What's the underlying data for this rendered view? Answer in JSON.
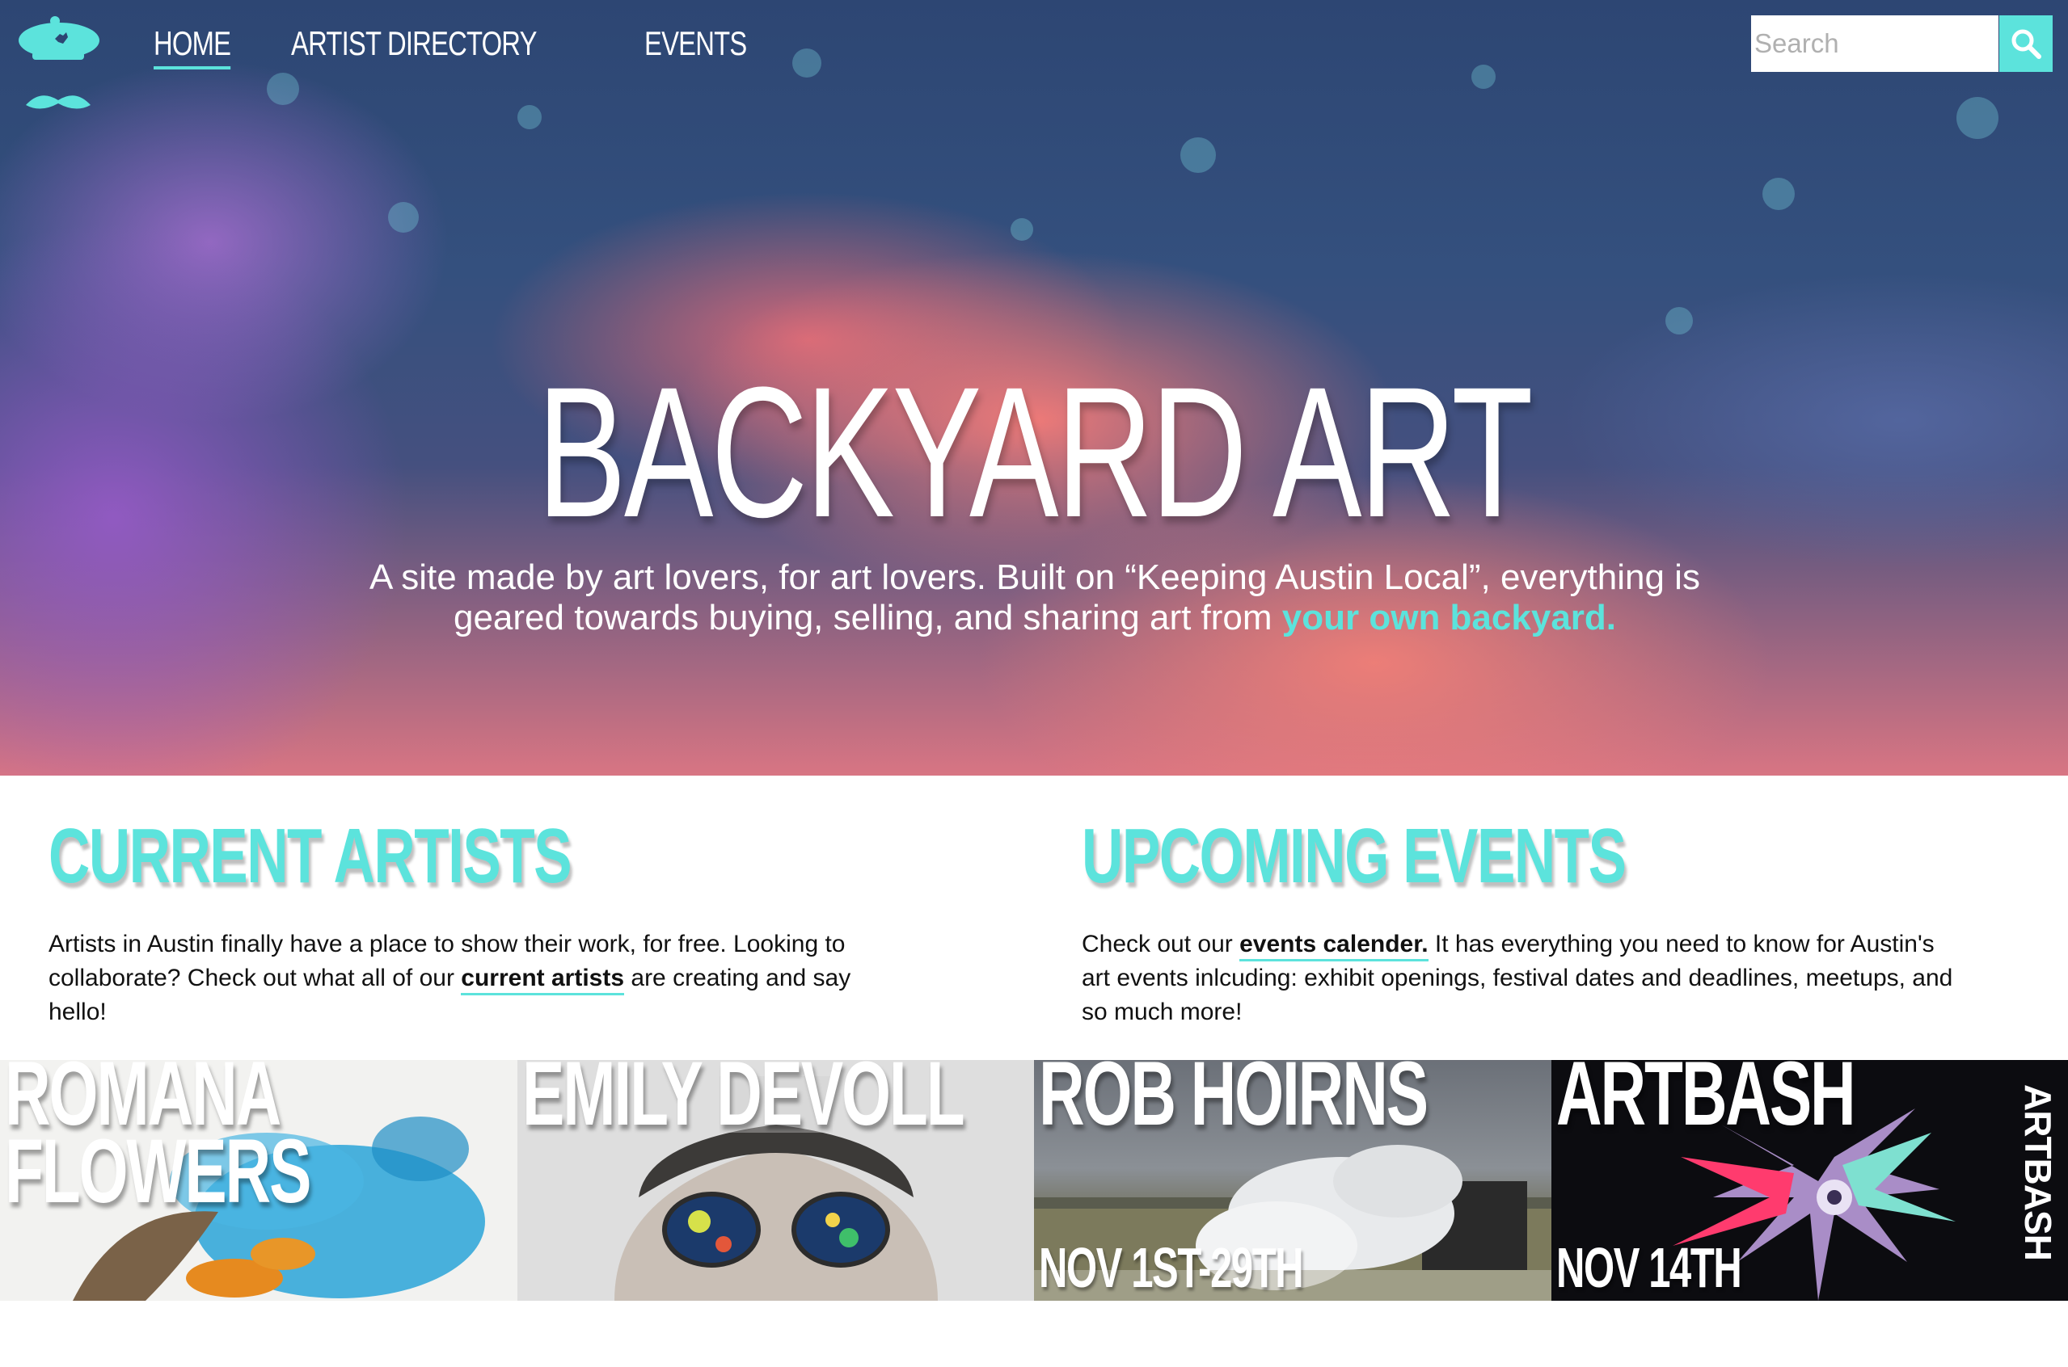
{
  "nav": {
    "items": [
      {
        "label": "HOME",
        "active": true
      },
      {
        "label": "ARTIST DIRECTORY",
        "active": false
      },
      {
        "label": "EVENTS",
        "active": false
      }
    ]
  },
  "search": {
    "placeholder": "Search",
    "icon": "search-icon"
  },
  "hero": {
    "title": "BACKYARD ART",
    "subtitle_line1": "A site made by art lovers, for art lovers. Built on “Keeping Austin Local”, everything is",
    "subtitle_line2_prefix": "geared towards buying, selling, and sharing art from ",
    "subtitle_accent": "your own backyard."
  },
  "artists_section": {
    "heading": "CURRENT ARTISTS",
    "text_before": "Artists in Austin finally have a place to show their work, for free. Looking to collaborate? Check out what all of our ",
    "link": "current artists",
    "text_after": " are creating and say hello!"
  },
  "events_section": {
    "heading": "UPCOMING EVENTS",
    "text_before": "Check out our ",
    "link": "events calender.",
    "text_after": " It has everything you need to know for Austin's art events inlcuding: exhibit openings, festival dates and deadlines, meetups, and so much more!"
  },
  "tiles": [
    {
      "name": "ROMANA",
      "name2": "FLOWERS",
      "date": ""
    },
    {
      "name": "EMILY DEVOLL",
      "date": ""
    },
    {
      "name": "ROB HOIRNS",
      "date": "NOV 1ST-29TH"
    },
    {
      "name": "ARTBASH",
      "date": "NOV 14TH",
      "side_text": "ARTBASH"
    }
  ],
  "colors": {
    "accent": "#5ce3dc",
    "text": "#111111",
    "white": "#ffffff"
  }
}
